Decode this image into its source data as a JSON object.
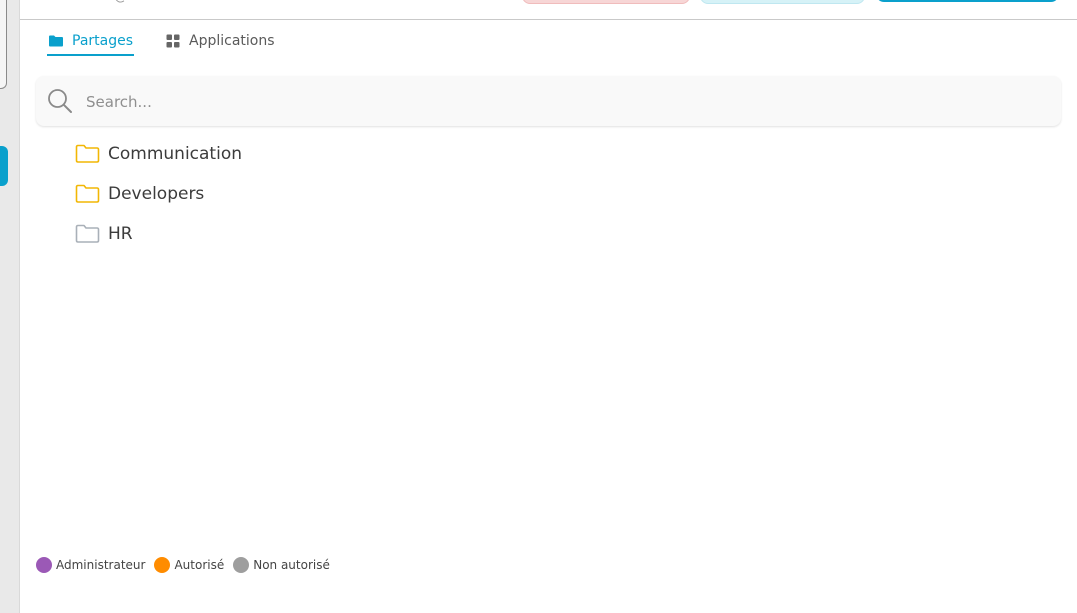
{
  "header": {
    "partial_text": "@"
  },
  "tabs": [
    {
      "label": "Partages",
      "active": true,
      "icon": "folder-icon"
    },
    {
      "label": "Applications",
      "active": false,
      "icon": "grid-icon"
    }
  ],
  "search": {
    "placeholder": "Search...",
    "value": "",
    "icon": "search-icon"
  },
  "folders": [
    {
      "name": "Communication",
      "icon": "folder-icon",
      "color": "#f2b705"
    },
    {
      "name": "Developers",
      "icon": "folder-icon",
      "color": "#f2b705"
    },
    {
      "name": "HR",
      "icon": "folder-icon",
      "color": "#a9b0b8"
    }
  ],
  "legend": [
    {
      "label": "Administrateur",
      "color": "#9b59b6"
    },
    {
      "label": "Autorisé",
      "color": "#ff8c00"
    },
    {
      "label": "Non autorisé",
      "color": "#9e9e9e"
    }
  ],
  "colors": {
    "accent": "#0aa0cc"
  }
}
